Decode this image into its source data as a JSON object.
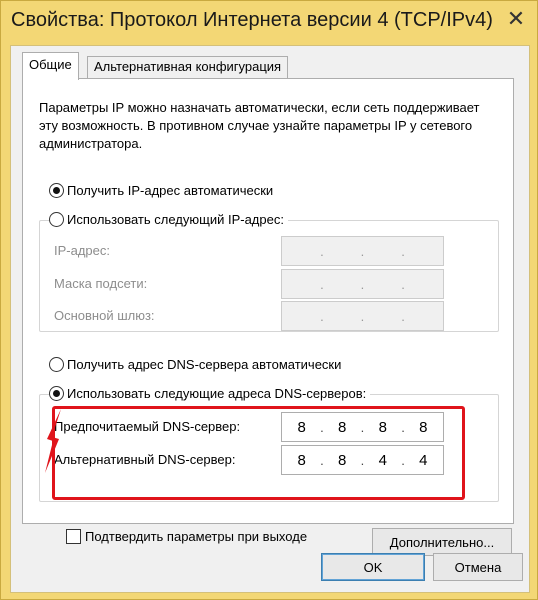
{
  "window": {
    "title": "Свойства: Протокол Интернета версии 4 (TCP/IPv4)",
    "close_glyph": "✕"
  },
  "tabs": [
    {
      "label": "Общие",
      "active": true
    },
    {
      "label": "Альтернативная конфигурация",
      "active": false
    }
  ],
  "description": "Параметры IP можно назначать автоматически, если сеть поддерживает эту возможность. В противном случае узнайте параметры IP у сетевого администратора.",
  "ip_mode": {
    "auto_label": "Получить IP-адрес автоматически",
    "manual_label": "Использовать следующий IP-адрес:",
    "selected": "auto",
    "fields": [
      {
        "label": "IP-адрес:"
      },
      {
        "label": "Маска подсети:"
      },
      {
        "label": "Основной шлюз:"
      }
    ]
  },
  "dns_mode": {
    "auto_label": "Получить адрес DNS-сервера автоматически",
    "manual_label": "Использовать следующие адреса DNS-серверов:",
    "selected": "manual",
    "preferred": {
      "label": "Предпочитаемый DNS-сервер:",
      "octets": [
        "8",
        "8",
        "8",
        "8"
      ]
    },
    "alternate": {
      "label": "Альтернативный DNS-сервер:",
      "octets": [
        "8",
        "8",
        "4",
        "4"
      ]
    }
  },
  "validate_checkbox": {
    "label": "Подтвердить параметры при выходе",
    "checked": false
  },
  "buttons": {
    "advanced": "Дополнительно...",
    "ok": "OK",
    "cancel": "Отмена"
  },
  "colors": {
    "highlight": "#e0141b",
    "window_frame": "#f3d775"
  }
}
